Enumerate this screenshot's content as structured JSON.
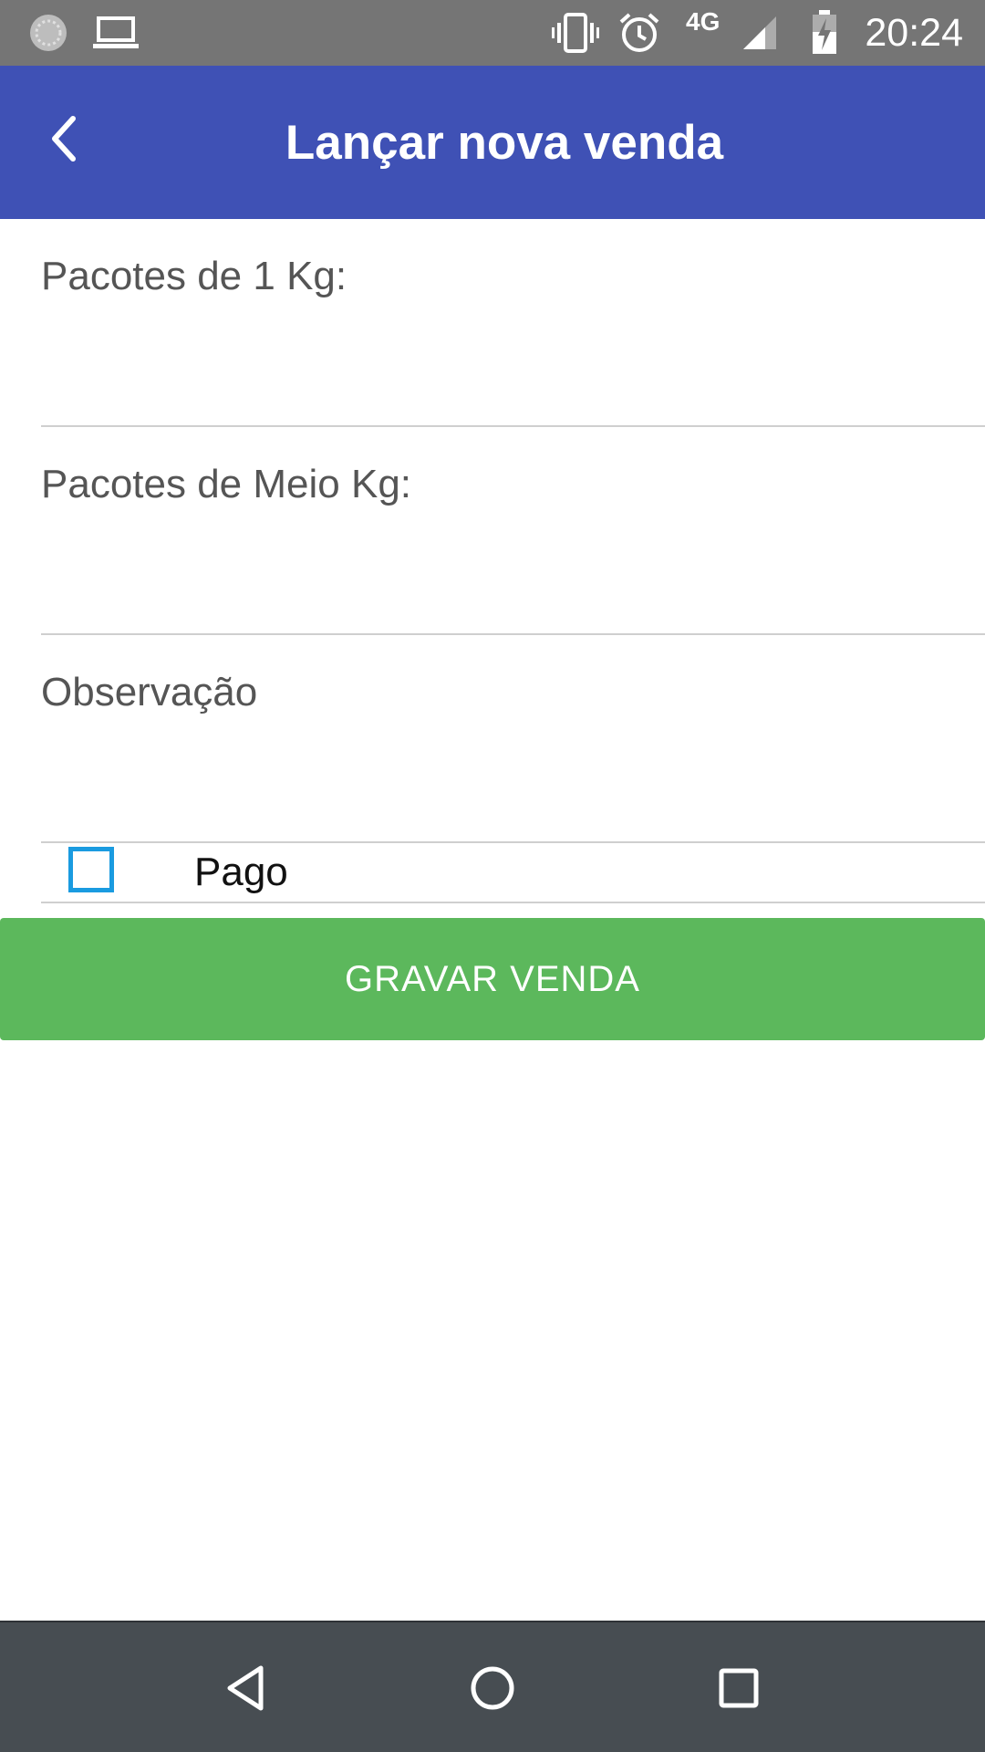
{
  "status_bar": {
    "time": "20:24",
    "network": "4G",
    "icons": [
      "sync-icon",
      "laptop-icon",
      "vibrate-icon",
      "alarm-icon",
      "network-4g-icon",
      "signal-icon",
      "battery-charging-icon"
    ]
  },
  "app_bar": {
    "title": "Lançar nova venda",
    "back_icon": "chevron-left-icon",
    "color": "#3f51b5"
  },
  "form": {
    "pacotes_1kg": {
      "placeholder": "Pacotes de 1 Kg:",
      "value": ""
    },
    "pacotes_meio_kg": {
      "placeholder": "Pacotes de Meio Kg:",
      "value": ""
    },
    "observacao": {
      "placeholder": "Observação",
      "value": ""
    },
    "pago": {
      "label": "Pago",
      "checked": false
    },
    "save_label": "GRAVAR VENDA",
    "save_color": "#5cb85c"
  },
  "nav_bar": {
    "icons": [
      "back-triangle-icon",
      "home-circle-icon",
      "recents-square-icon"
    ]
  }
}
